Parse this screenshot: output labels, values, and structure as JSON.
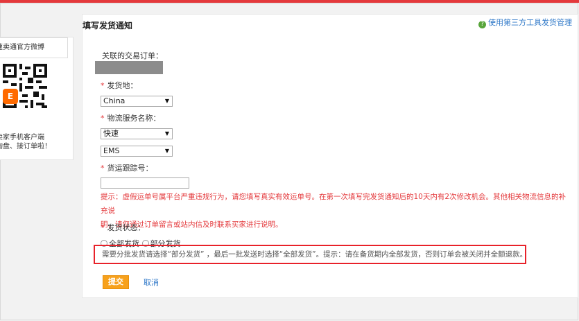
{
  "sidebar": {
    "weibo_label": "速卖通官方微博",
    "app_badge": "E",
    "app_text_line1": "卖家手机客户端",
    "app_text_line2": "询盘、接订单啦！"
  },
  "panel": {
    "title": "填写发货通知",
    "help_icon": "?",
    "help_link": "使用第三方工具发货管理"
  },
  "form": {
    "order_label": "关联的交易订单：",
    "origin_label": "发货地：",
    "origin_value": "China",
    "service_label": "物流服务名称：",
    "service_type_value": "快速",
    "service_value": "EMS",
    "tracking_label": "货运跟踪号：",
    "tracking_value": "",
    "warning_line1": "提示：虚假运单号属平台严重违规行为，请您填写真实有效运单号。在第一次填写完发货通知后的10天内有2次修改机会。其他相关物流信息的补充说",
    "warning_line2": "明，请您通过订单留言或站内信及时联系买家进行说明。",
    "status_label": "发货状态：",
    "status_full": "全部发货",
    "status_partial": "部分发货",
    "notice_text": "需要分批发货请选择“部分发货” ，最后一批发送时选择“全部发货”。提示：请在备货期内全部发货，否则订单会被关闭并全额退款。",
    "submit_label": "提交",
    "cancel_label": "取消"
  },
  "colors": {
    "accent_red": "#e4393c",
    "link_blue": "#2f78c8",
    "button_orange": "#f7a11c"
  },
  "icons": {
    "select_arrow": "▼",
    "required_mark": "*"
  }
}
